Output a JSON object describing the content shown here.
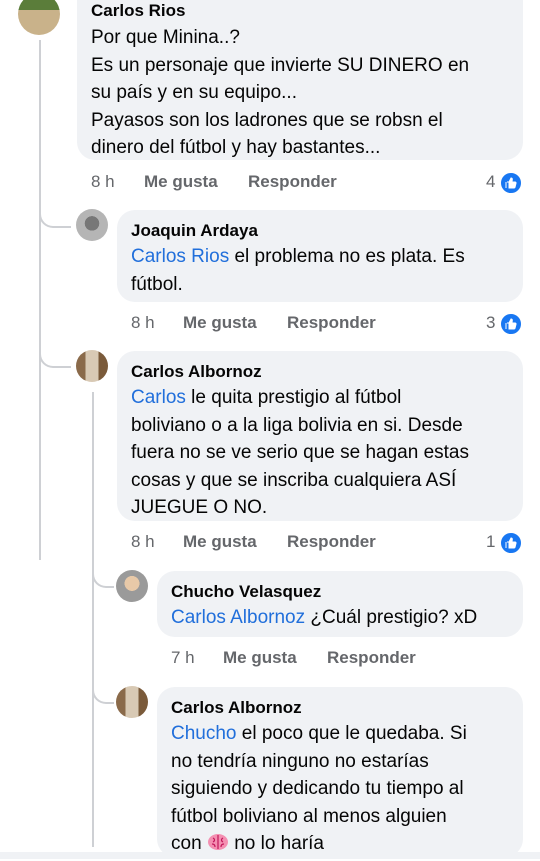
{
  "comments": [
    {
      "author": "Carlos Rios",
      "lines": [
        "Por que Minina..?",
        "Es un personaje que invierte SU DINERO en",
        "su país y en su equipo...",
        "Payasos son los ladrones que se robsn el",
        "dinero del fútbol y hay bastantes..."
      ],
      "time": "8 h",
      "like": "Me gusta",
      "reply": "Responder",
      "reaction_count": "4"
    },
    {
      "author": "Joaquin Ardaya",
      "mention": "Carlos Rios",
      "line1_rest": " el problema no es plata. Es",
      "line2": "fútbol.",
      "time": "8 h",
      "like": "Me gusta",
      "reply": "Responder",
      "reaction_count": "3"
    },
    {
      "author": "Carlos Albornoz",
      "mention": "Carlos",
      "line1_rest": " le quita prestigio al fútbol",
      "lines": [
        "boliviano o a la liga bolivia en si. Desde",
        "fuera no se ve serio que se hagan estas",
        "cosas y que se inscriba cualquiera ASÍ",
        "JUEGUE O NO."
      ],
      "time": "8 h",
      "like": "Me gusta",
      "reply": "Responder",
      "reaction_count": "1"
    },
    {
      "author": "Chucho Velasquez",
      "mention": "Carlos Albornoz",
      "line1_rest": " ¿Cuál prestigio? xD",
      "time": "7 h",
      "like": "Me gusta",
      "reply": "Responder"
    },
    {
      "author": "Carlos Albornoz",
      "mention": "Chucho",
      "line1_rest": " el poco que le quedaba. Si",
      "lines": [
        "no tendría ninguno no estarías",
        "siguiendo y dedicando tu tiempo al",
        "fútbol boliviano al menos alguien"
      ],
      "last_pre": "con ",
      "last_post": " no lo haría",
      "emoji": "brain-emoji"
    }
  ],
  "colors": {
    "bubble": "#f0f2f5",
    "mention": "#216fdb",
    "meta": "#65676b",
    "like": "#1877f2"
  }
}
